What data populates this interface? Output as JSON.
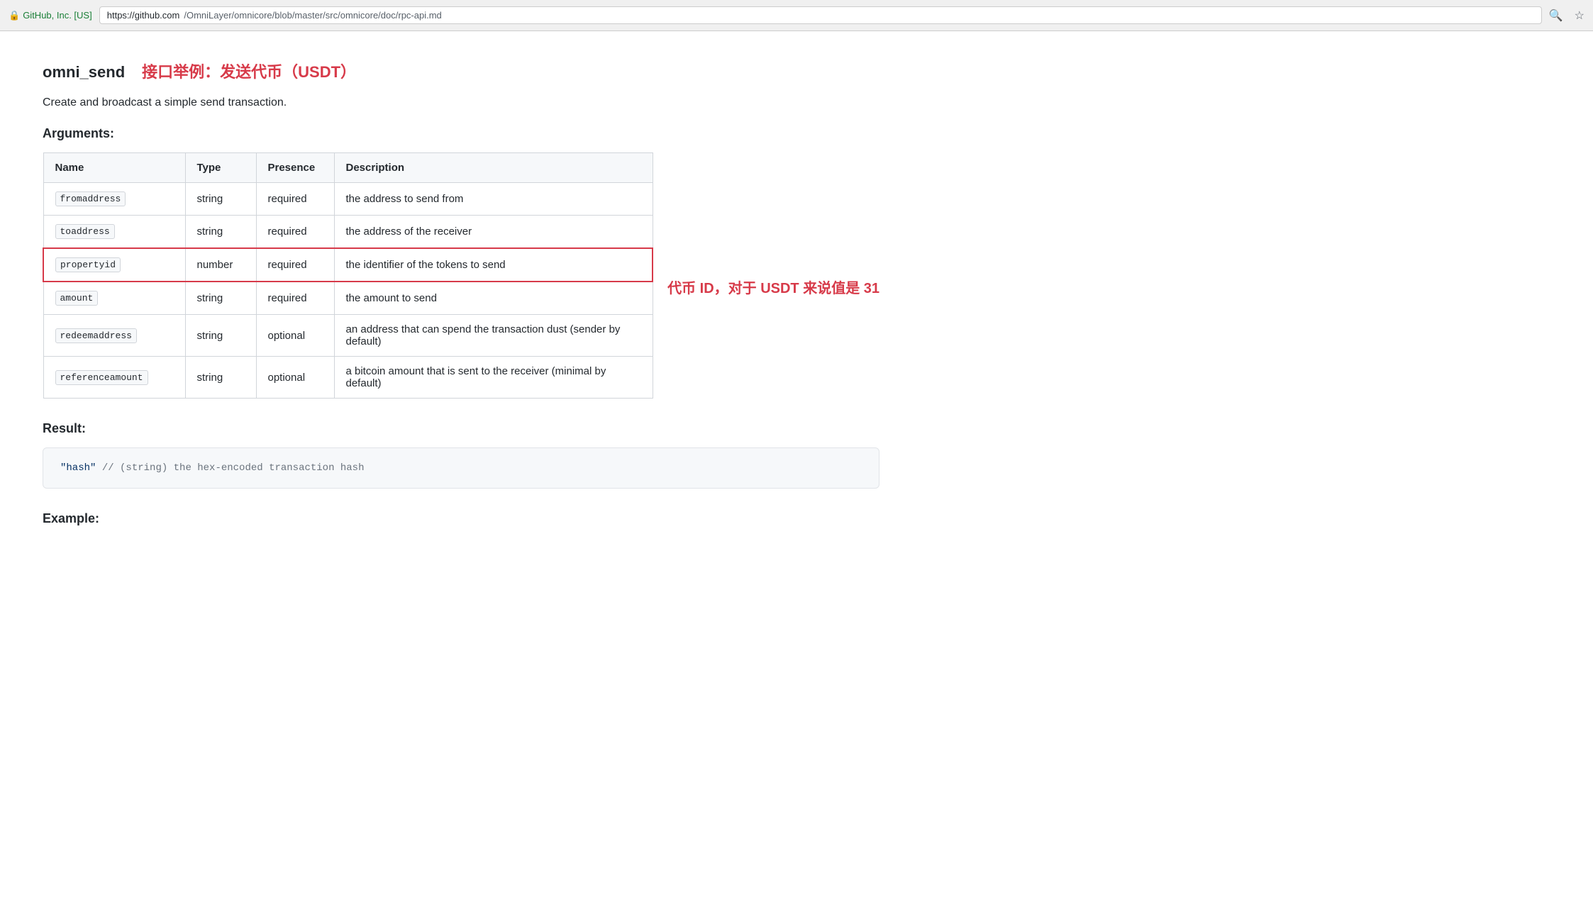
{
  "browser": {
    "security_label": "GitHub, Inc. [US]",
    "url_origin": "https://github.com",
    "url_path": "/OmniLayer/omnicore/blob/master/src/omnicore/doc/rpc-api.md",
    "search_icon": "🔍",
    "star_icon": "☆"
  },
  "page": {
    "api_name": "omni_send",
    "api_subtitle": "接口举例：发送代币（USDT）",
    "description": "Create and broadcast a simple send transaction.",
    "arguments_label": "Arguments:",
    "result_label": "Result:",
    "example_label": "Example:",
    "table": {
      "headers": [
        "Name",
        "Type",
        "Presence",
        "Description"
      ],
      "rows": [
        {
          "name": "fromaddress",
          "type": "string",
          "presence": "required",
          "description": "the address to send from",
          "highlighted": false
        },
        {
          "name": "toaddress",
          "type": "string",
          "presence": "required",
          "description": "the address of the receiver",
          "highlighted": false
        },
        {
          "name": "propertyid",
          "type": "number",
          "presence": "required",
          "description": "the identifier of the tokens to send",
          "highlighted": true
        },
        {
          "name": "amount",
          "type": "string",
          "presence": "required",
          "description": "the amount to send",
          "highlighted": false
        },
        {
          "name": "redeemaddress",
          "type": "string",
          "presence": "optional",
          "description": "an address that can spend the transaction dust (sender by default)",
          "highlighted": false
        },
        {
          "name": "referenceamount",
          "type": "string",
          "presence": "optional",
          "description": "a bitcoin amount that is sent to the receiver (minimal by default)",
          "highlighted": false
        }
      ]
    },
    "annotation": "代币 ID，对于 USDT 来说值是 31",
    "code_block": "\"hash\"  // (string) the hex-encoded transaction hash"
  }
}
